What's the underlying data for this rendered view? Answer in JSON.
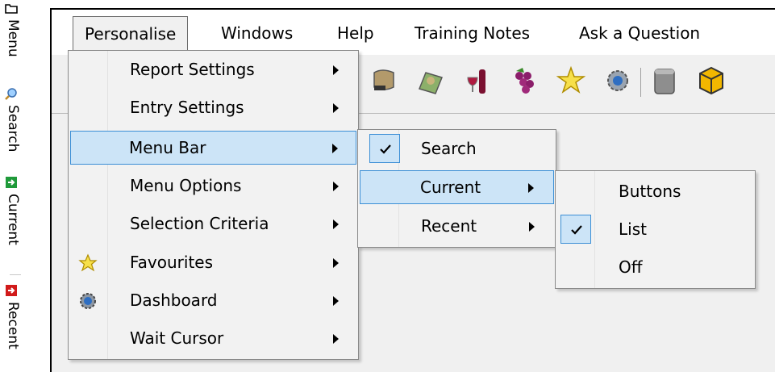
{
  "sidebar": {
    "items": [
      {
        "label": "Menu",
        "icon": "folder-icon"
      },
      {
        "label": "Search",
        "icon": "magnifier-icon"
      },
      {
        "label": "Current",
        "icon": "green-arrow-icon"
      },
      {
        "label": "Recent",
        "icon": "red-arrow-icon"
      }
    ]
  },
  "menubar": {
    "items": [
      {
        "label": "Personalise"
      },
      {
        "label": "Windows"
      },
      {
        "label": "Help"
      },
      {
        "label": "Training Notes"
      },
      {
        "label": "Ask a Question"
      }
    ]
  },
  "toolbar": {
    "icons": [
      "scroll-icon",
      "map-icon",
      "wine-icon",
      "grapes-icon",
      "star-icon",
      "gear-icon",
      "barrel-icon",
      "box-icon"
    ]
  },
  "personalise_menu": {
    "items": [
      {
        "label": "Report Settings"
      },
      {
        "label": "Entry Settings"
      },
      {
        "label": "Menu Bar",
        "highlighted": true
      },
      {
        "label": "Menu Options"
      },
      {
        "label": "Selection Criteria"
      },
      {
        "label": "Favourites",
        "icon": "star-icon"
      },
      {
        "label": "Dashboard",
        "icon": "dashboard-gear-icon"
      },
      {
        "label": "Wait Cursor"
      }
    ]
  },
  "menubar_submenu": {
    "items": [
      {
        "label": "Search",
        "checked": true
      },
      {
        "label": "Current",
        "highlighted": true
      },
      {
        "label": "Recent"
      }
    ]
  },
  "current_submenu": {
    "items": [
      {
        "label": "Buttons"
      },
      {
        "label": "List",
        "checked": true
      },
      {
        "label": "Off"
      }
    ]
  },
  "colors": {
    "highlight_bg": "#cce4f7",
    "highlight_border": "#3c8fd6",
    "menu_bg": "#f2f2f2"
  }
}
